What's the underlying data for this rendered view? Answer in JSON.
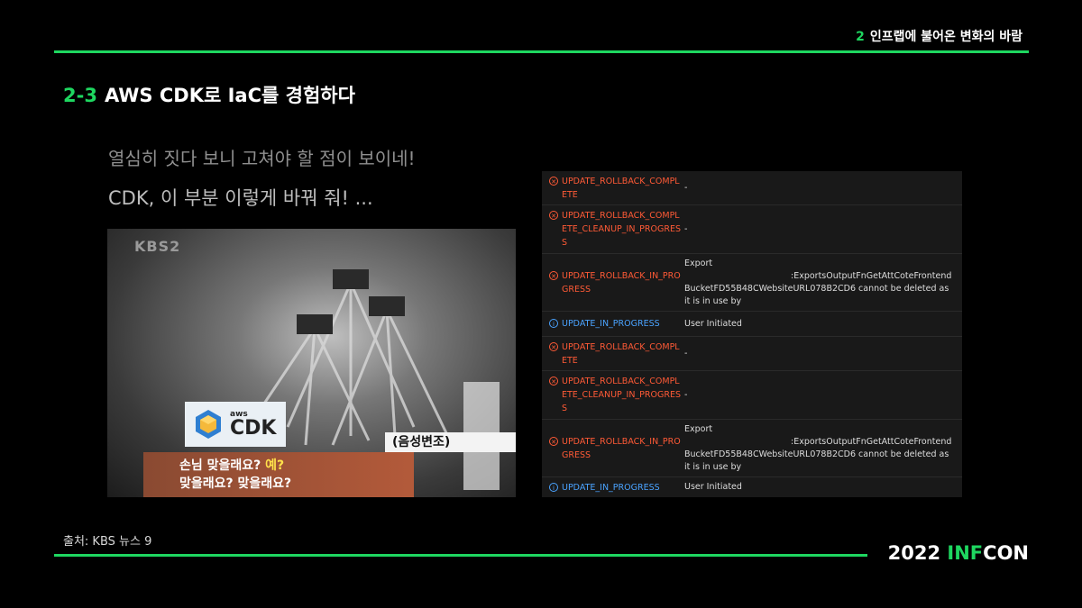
{
  "header": {
    "section_num": "2",
    "section_title": "인프랩에 불어온 변화의 바람"
  },
  "slide": {
    "title_num": "2-3",
    "title_text": "AWS CDK로 IaC를 경험하다",
    "line1": "열심히 짓다 보니 고쳐야 할 점이 보이네!",
    "line2": "CDK, 이 부분 이렇게 바꿔 줘! ..."
  },
  "image": {
    "broadcaster": "KBS2",
    "caption_top": "(음성변조)",
    "caption_line1_a": "손님 맞을래요?",
    "caption_line1_b": "예?",
    "caption_line2": "맞을래요? 맞을래요?",
    "logo_aws": "aws",
    "logo_name": "CDK"
  },
  "events": [
    {
      "status": "UPDATE_ROLLBACK_COMPLETE",
      "kind": "error",
      "reason": "-"
    },
    {
      "status": "UPDATE_ROLLBACK_COMPLETE_CLEANUP_IN_PROGRESS",
      "kind": "error",
      "reason": "-"
    },
    {
      "status": "UPDATE_ROLLBACK_IN_PROGRESS",
      "kind": "error",
      "reason_a": "Export",
      "reason_b": ":ExportsOutputFnGetAttCoteFrontend",
      "reason_c": "BucketFD55B48CWebsiteURL078B2CD6 cannot be deleted as it is in use by"
    },
    {
      "status": "UPDATE_IN_PROGRESS",
      "kind": "info",
      "reason": "User Initiated"
    },
    {
      "status": "UPDATE_ROLLBACK_COMPLETE",
      "kind": "error",
      "reason": "-"
    },
    {
      "status": "UPDATE_ROLLBACK_COMPLETE_CLEANUP_IN_PROGRESS",
      "kind": "error",
      "reason": "-"
    },
    {
      "status": "UPDATE_ROLLBACK_IN_PROGRESS",
      "kind": "error",
      "reason_a": "Export",
      "reason_b": ":ExportsOutputFnGetAttCoteFrontend",
      "reason_c": "BucketFD55B48CWebsiteURL078B2CD6 cannot be deleted as it is in use by"
    },
    {
      "status": "UPDATE_IN_PROGRESS",
      "kind": "info",
      "reason": "User Initiated"
    }
  ],
  "footer": {
    "source": "출처: KBS 뉴스 9",
    "brand_year": "2022",
    "brand_a": "INF",
    "brand_b": "CON"
  },
  "colors": {
    "accent": "#1ed760",
    "error": "#ff5a36",
    "info": "#4aa3ff"
  }
}
